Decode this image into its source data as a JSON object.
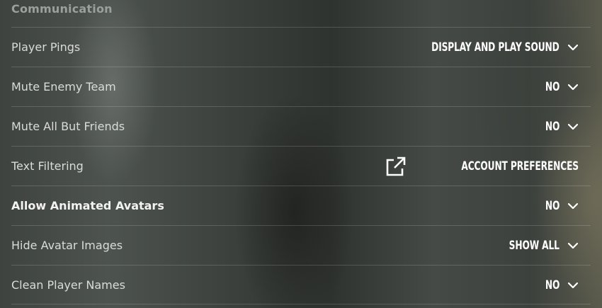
{
  "section": {
    "title": "Communication"
  },
  "rows": [
    {
      "label": "Player Pings",
      "value": "DISPLAY AND PLAY SOUND"
    },
    {
      "label": "Mute Enemy Team",
      "value": "NO"
    },
    {
      "label": "Mute All But Friends",
      "value": "NO"
    },
    {
      "label": "Text Filtering",
      "link": "ACCOUNT PREFERENCES"
    },
    {
      "label": "Allow Animated Avatars",
      "value": "NO"
    },
    {
      "label": "Hide Avatar Images",
      "value": "SHOW ALL"
    },
    {
      "label": "Clean Player Names",
      "value": "NO"
    }
  ],
  "icons": {
    "dropdown": "chevron-down-icon",
    "external": "external-link-icon"
  }
}
